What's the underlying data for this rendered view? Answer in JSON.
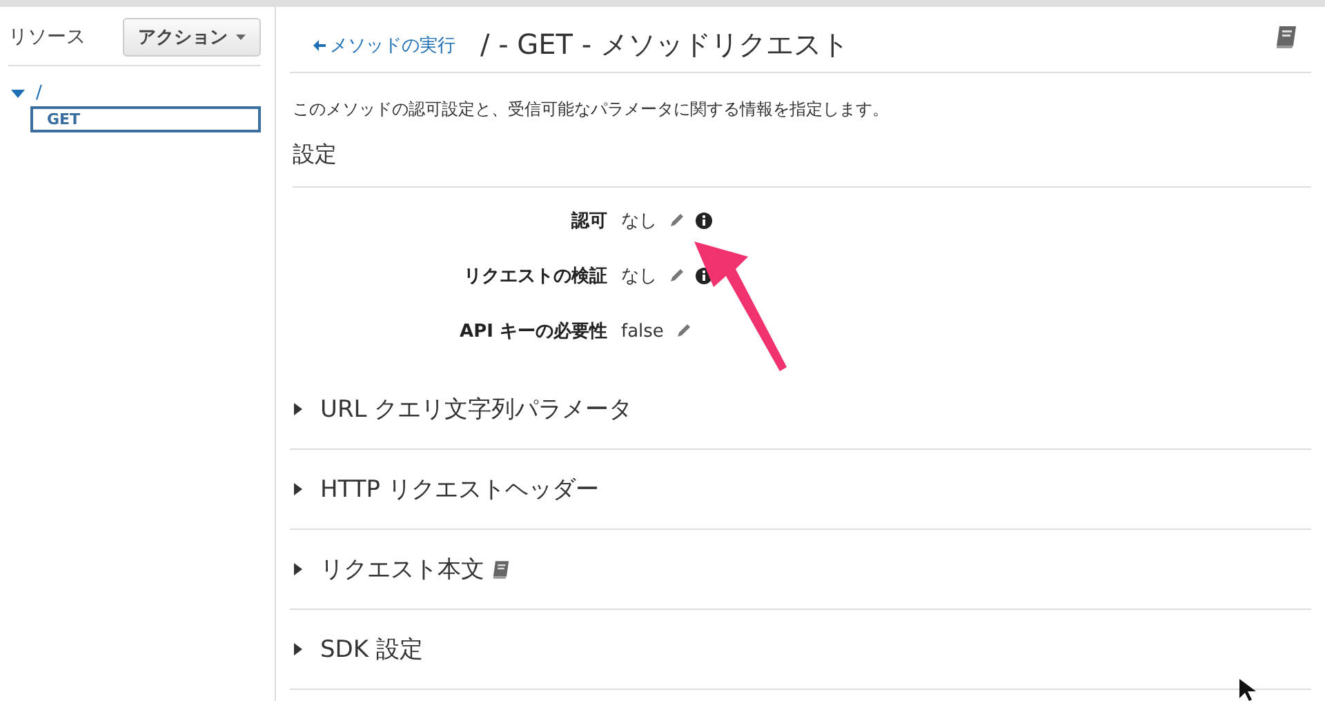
{
  "sidebar": {
    "title": "リソース",
    "action_button": "アクション",
    "tree": [
      {
        "label": "/",
        "expanded": true,
        "selected": false,
        "children": [
          {
            "label": "GET",
            "selected": true
          }
        ]
      }
    ]
  },
  "header": {
    "back_link": "メソッドの実行",
    "title": "/ - GET - メソッドリクエスト"
  },
  "description": "このメソッドの認可設定と、受信可能なパラメータに関する情報を指定します。",
  "settings": {
    "heading": "設定",
    "rows": [
      {
        "label": "認可",
        "value": "なし",
        "info_icon": true
      },
      {
        "label": "リクエストの検証",
        "value": "なし",
        "info_icon": true
      },
      {
        "label": "API キーの必要性",
        "value": "false",
        "info_icon": false
      }
    ]
  },
  "sections": [
    {
      "label": "URL クエリ文字列パラメータ",
      "expanded": false,
      "doc_icon": false
    },
    {
      "label": "HTTP リクエストヘッダー",
      "expanded": false,
      "doc_icon": false
    },
    {
      "label": "リクエスト本文",
      "expanded": false,
      "doc_icon": true
    },
    {
      "label": "SDK 設定",
      "expanded": false,
      "doc_icon": false
    }
  ]
}
